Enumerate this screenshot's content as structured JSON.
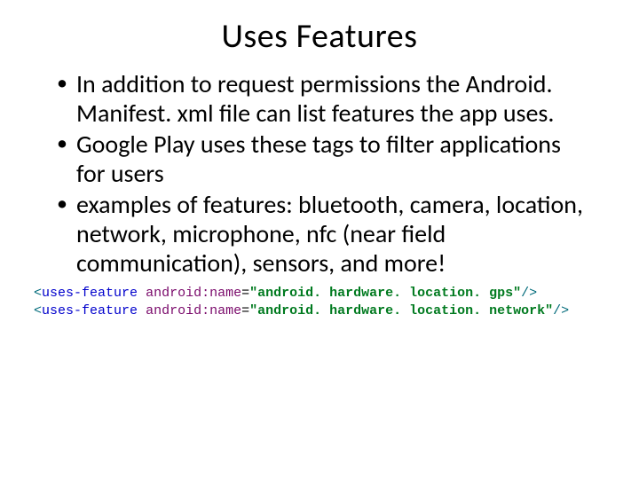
{
  "title": "Uses Features",
  "bullets": [
    "In addition to request permissions the Android. Manifest. xml file can list features the app uses.",
    "Google Play uses these tags to filter applications for users",
    "examples of features: bluetooth, camera, location, network, microphone, nfc (near field communication), sensors, and more!"
  ],
  "code": {
    "line1": {
      "open": "<",
      "tag": "uses-feature",
      "sp": " ",
      "attr": "android:name",
      "eq": "=",
      "val": "\"android. hardware. location. gps\"",
      "close": "/>"
    },
    "line2": {
      "open": "<",
      "tag": "uses-feature",
      "sp": " ",
      "attr": "android:name",
      "eq": "=",
      "val": "\"android. hardware. location. network\"",
      "close": "/>"
    }
  }
}
